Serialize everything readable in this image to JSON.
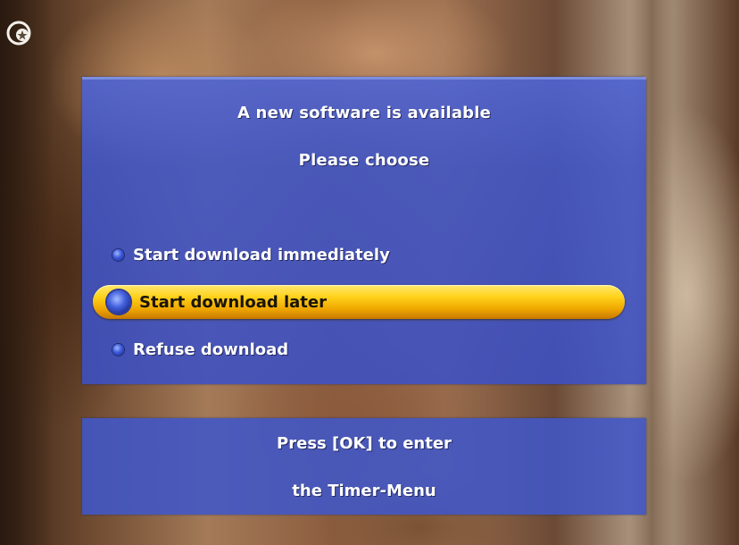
{
  "dialog": {
    "title_line1": "A new software is available",
    "title_line2": "Please choose",
    "options": [
      {
        "label": "Start download immediately",
        "selected": false
      },
      {
        "label": "Start download later",
        "selected": true
      },
      {
        "label": "Refuse download",
        "selected": false
      }
    ]
  },
  "footer": {
    "line1": "Press [OK] to enter",
    "line2": "the Timer-Menu"
  },
  "icons": {
    "top_left": "logo-mark-icon",
    "option_bullet": "radio-bullet-icon"
  },
  "colors": {
    "panel": "#4056c8",
    "highlight": "#ffd21a",
    "text": "#ffffff",
    "selected_text": "#1a1408"
  }
}
